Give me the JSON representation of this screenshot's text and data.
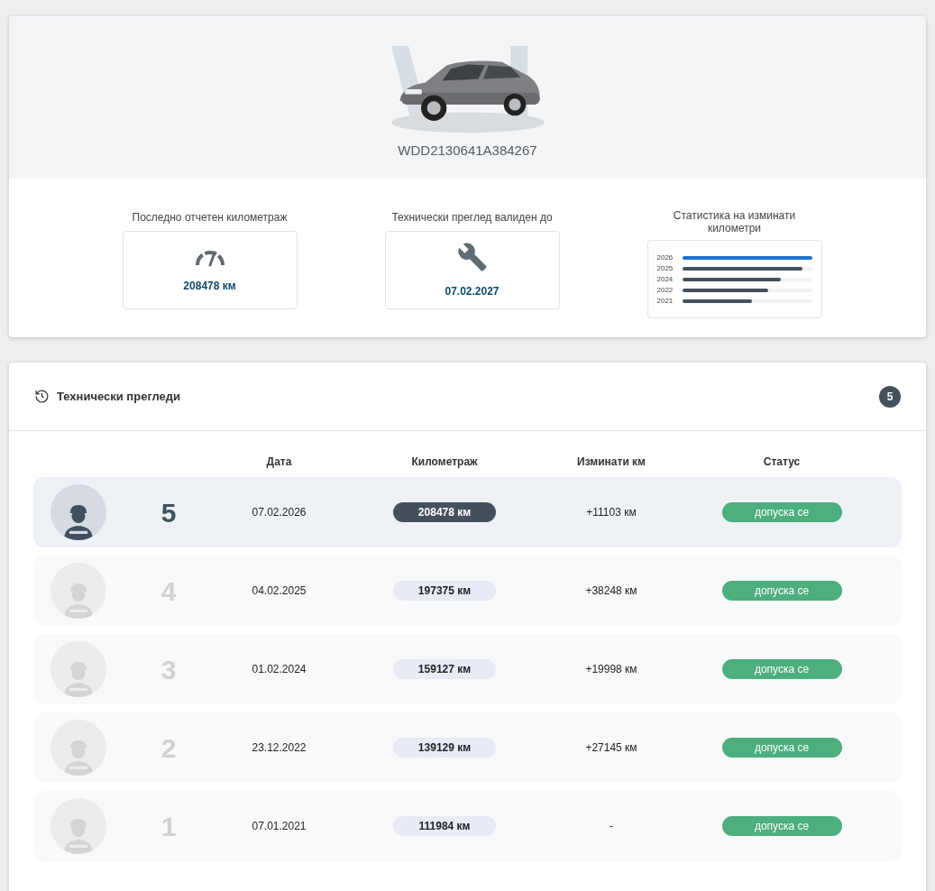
{
  "vehicle": {
    "vin": "WDD2130641A384267"
  },
  "summary": [
    {
      "kind": "mileage",
      "label": "Последно отчетен километраж",
      "value": "208478 км"
    },
    {
      "kind": "inspection",
      "label": "Технически преглед валиден до",
      "value": "07.02.2027"
    }
  ],
  "stats": {
    "label": "Статистика на изминати километри",
    "bars": [
      {
        "year": "2026",
        "level": 1.0,
        "selected": true
      },
      {
        "year": "2025",
        "level": 0.93,
        "selected": false
      },
      {
        "year": "2024",
        "level": 0.76,
        "selected": false
      },
      {
        "year": "2022",
        "level": 0.66,
        "selected": false
      },
      {
        "year": "2021",
        "level": 0.54,
        "selected": false
      }
    ]
  },
  "inspections": {
    "title": "Технически прегледи",
    "count": "5",
    "columns": [
      "Дата",
      "Километраж",
      "Изминати км",
      "Статус"
    ],
    "rows": [
      {
        "number": "5",
        "date": "07.02.2026",
        "mileage": "208478 км",
        "driven": "+11103 км",
        "status": "допуска се",
        "selected": true
      },
      {
        "number": "4",
        "date": "04.02.2025",
        "mileage": "197375 км",
        "driven": "+38248 км",
        "status": "допуска се",
        "selected": false
      },
      {
        "number": "3",
        "date": "01.02.2024",
        "mileage": "159127 км",
        "driven": "+19998 км",
        "status": "допуска се",
        "selected": false
      },
      {
        "number": "2",
        "date": "23.12.2022",
        "mileage": "139129 км",
        "driven": "+27145 км",
        "status": "допуска се",
        "selected": false
      },
      {
        "number": "1",
        "date": "07.01.2021",
        "mileage": "111984 км",
        "driven": "-",
        "status": "допуска се",
        "selected": false
      }
    ]
  }
}
